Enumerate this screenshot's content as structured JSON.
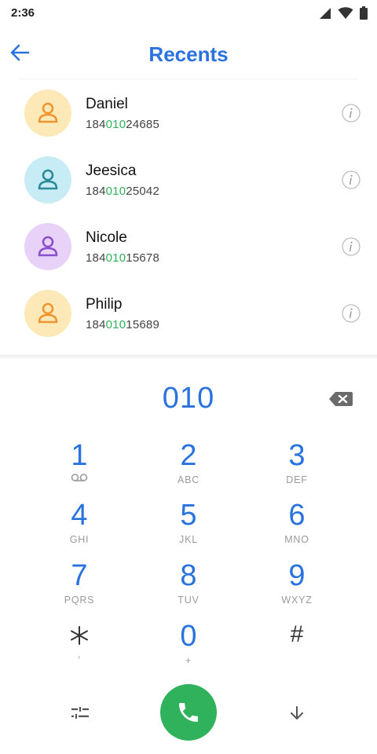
{
  "status_bar": {
    "time": "2:36"
  },
  "header": {
    "title": "Recents"
  },
  "recents": [
    {
      "name": "Daniel",
      "number_prefix": "184",
      "number_match": "010",
      "number_suffix": "24685",
      "avatar_bg": "#fde9b8",
      "avatar_fg": "#f0952e"
    },
    {
      "name": "Jeesica",
      "number_prefix": "184",
      "number_match": "010",
      "number_suffix": "25042",
      "avatar_bg": "#c8ecf6",
      "avatar_fg": "#2b8b98"
    },
    {
      "name": "Nicole",
      "number_prefix": "184",
      "number_match": "010",
      "number_suffix": "15678",
      "avatar_bg": "#e8d2f8",
      "avatar_fg": "#8a4fcf"
    },
    {
      "name": "Philip",
      "number_prefix": "184",
      "number_match": "010",
      "number_suffix": "15689",
      "avatar_bg": "#fde9b8",
      "avatar_fg": "#f0952e"
    }
  ],
  "dialer": {
    "input_value": "010",
    "keys": [
      {
        "digit": "1",
        "letters": ""
      },
      {
        "digit": "2",
        "letters": "ABC"
      },
      {
        "digit": "3",
        "letters": "DEF"
      },
      {
        "digit": "4",
        "letters": "GHI"
      },
      {
        "digit": "5",
        "letters": "JKL"
      },
      {
        "digit": "6",
        "letters": "MNO"
      },
      {
        "digit": "7",
        "letters": "PQRS"
      },
      {
        "digit": "8",
        "letters": "TUV"
      },
      {
        "digit": "9",
        "letters": "WXYZ"
      },
      {
        "digit": "*",
        "letters": ","
      },
      {
        "digit": "0",
        "letters": "+"
      },
      {
        "digit": "#",
        "letters": ""
      }
    ]
  },
  "colors": {
    "accent": "#2a73de",
    "call_green": "#2fb25b",
    "match_green": "#2fb25b"
  }
}
